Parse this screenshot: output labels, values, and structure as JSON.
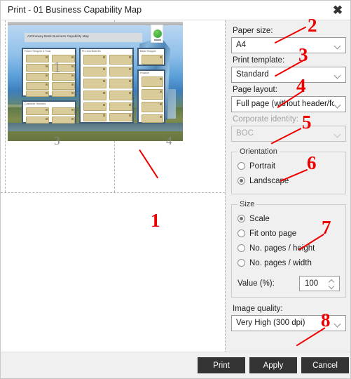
{
  "window": {
    "title": "Print - 01 Business Capability Map",
    "close_icon": "close-icon"
  },
  "preview": {
    "document_title": "A2Oneway Bank Business Capability Map",
    "page_numbers": [
      "1",
      "3",
      "4"
    ],
    "capability_groups": [
      "Future Shopper & Trust",
      "Pro and Build Ex",
      "Bank Shopper",
      "Finance",
      "Customer Services"
    ],
    "logo_icon": "recycle-logo-icon"
  },
  "settings": {
    "paper_size": {
      "label": "Paper size:",
      "value": "A4",
      "chevron_icon": "chevron-down-icon"
    },
    "print_template": {
      "label": "Print template:",
      "value": "Standard",
      "chevron_icon": "chevron-down-icon"
    },
    "page_layout": {
      "label": "Page layout:",
      "value": "Full page (without header/footer",
      "chevron_icon": "chevron-down-icon"
    },
    "corporate_identity": {
      "label": "Corporate identity:",
      "value": "BOC",
      "disabled": true,
      "chevron_icon": "chevron-down-icon"
    },
    "orientation": {
      "legend": "Orientation",
      "options": [
        {
          "label": "Portrait",
          "selected": false
        },
        {
          "label": "Landscape",
          "selected": true
        }
      ]
    },
    "size": {
      "legend": "Size",
      "options": [
        {
          "label": "Scale",
          "selected": true
        },
        {
          "label": "Fit onto page",
          "selected": false
        },
        {
          "label": "No. pages / height",
          "selected": false
        },
        {
          "label": "No. pages / width",
          "selected": false
        }
      ],
      "value_label": "Value (%):",
      "value": "100",
      "spin_up_icon": "chevron-up-icon",
      "spin_down_icon": "chevron-down-icon"
    },
    "image_quality": {
      "label": "Image quality:",
      "value": "Very High (300 dpi)",
      "chevron_icon": "chevron-down-icon"
    }
  },
  "footer": {
    "print": "Print",
    "apply": "Apply",
    "cancel": "Cancel"
  },
  "annotations": {
    "accent_color": "#ee0000",
    "markers": [
      "1",
      "2",
      "3",
      "4",
      "5",
      "6",
      "7",
      "8"
    ]
  }
}
